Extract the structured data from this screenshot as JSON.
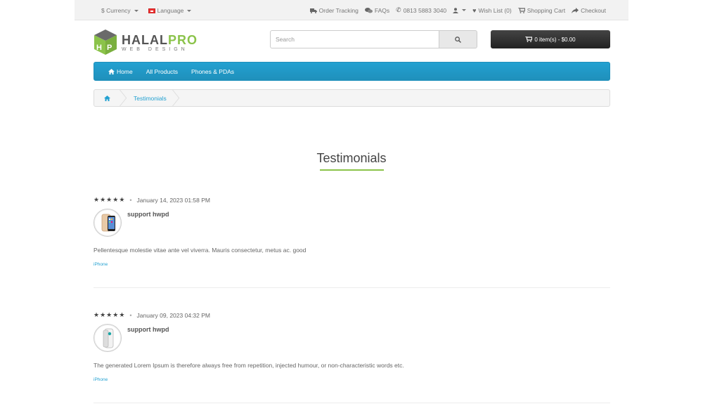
{
  "topbar": {
    "currency": "$ Currency",
    "language": "Language",
    "order_tracking": "Order Tracking",
    "faqs": "FAQs",
    "phone": "0813 5883 3040",
    "wishlist": "Wish List (0)",
    "shopping_cart": "Shopping Cart",
    "checkout": "Checkout"
  },
  "logo": {
    "name_a": "HALAL",
    "name_b": "PRO",
    "tagline": "WEB DESIGN"
  },
  "search": {
    "placeholder": "Search",
    "value": ""
  },
  "cart": {
    "label": "0 item(s) - $0.00"
  },
  "menu": {
    "items": [
      "Home",
      "All Products",
      "Phones & PDAs"
    ]
  },
  "breadcrumb": {
    "current": "Testimonials"
  },
  "page": {
    "title": "Testimonials"
  },
  "colors": {
    "accent": "#229ac8",
    "brand_green": "#8bc34a",
    "cart_bg": "#333333"
  },
  "reviews": [
    {
      "rating": 5,
      "date": "January 14, 2023 01:58 PM",
      "author": "support hwpd",
      "text": "Pellentesque molestie vitae ante vel viverra. Mauris consectetur, metus ac. good",
      "product": "iPhone"
    },
    {
      "rating": 5,
      "date": "January 09, 2023 04:32 PM",
      "author": "support hwpd",
      "text": "The generated Lorem Ipsum is therefore always free from repetition, injected humour, or non-characteristic words etc.",
      "product": "iPhone"
    }
  ]
}
